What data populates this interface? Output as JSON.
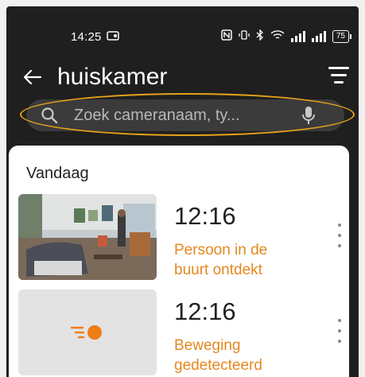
{
  "status_bar": {
    "time": "14:25",
    "notification_icon": "notification-icon",
    "battery": "75"
  },
  "app_bar": {
    "title": "huiskamer",
    "back_icon": "arrow-left-icon",
    "filter_icon": "filter-icon"
  },
  "search": {
    "placeholder": "Zoek cameranaam, ty...",
    "value": ""
  },
  "section": {
    "title": "Vandaag"
  },
  "events": [
    {
      "time": "12:16",
      "label_line1": "Persoon in de",
      "label_line2": "buurt ontdekt",
      "thumbnail": "camera-snapshot"
    },
    {
      "time": "12:16",
      "label_line1": "Beweging",
      "label_line2": "gedetecteerd",
      "thumbnail": "motion-icon"
    }
  ],
  "colors": {
    "accent": "#e5881f",
    "highlight_ring": "#e6a21a",
    "background": "#1f1f1f",
    "search_bg": "#3b3b3b"
  }
}
